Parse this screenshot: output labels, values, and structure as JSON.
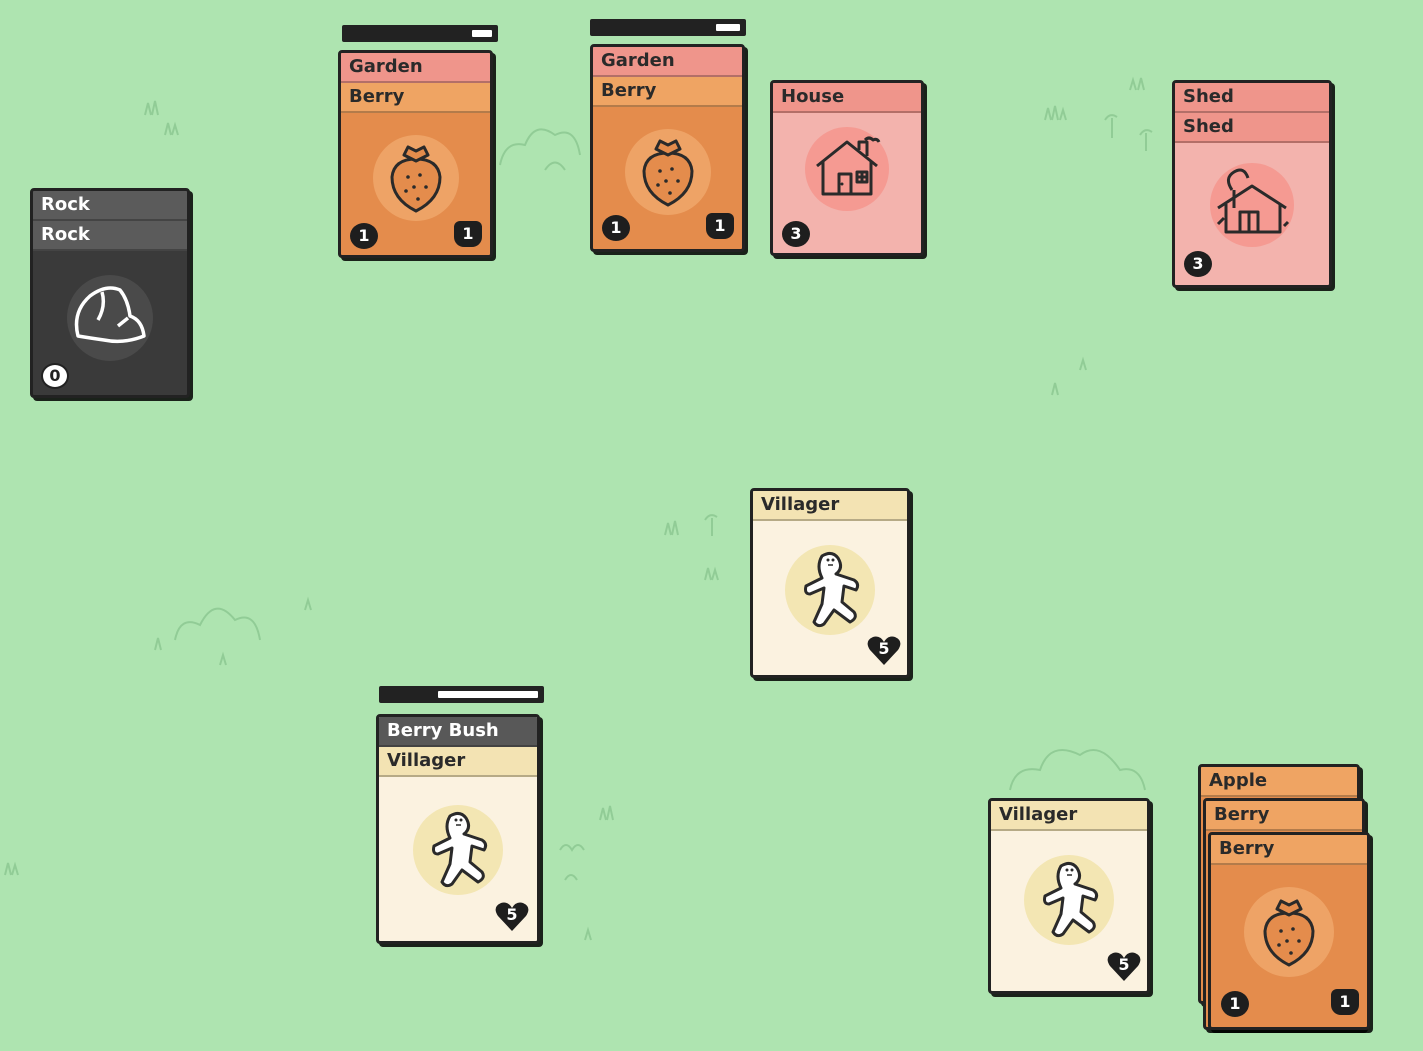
{
  "board": {
    "background": "#aee4b0",
    "colors": {
      "food": "#e48c4c",
      "structure": "#f3b3ad",
      "resource": "#3a3a3a",
      "villager": "#fbf2e0"
    }
  },
  "stacks": {
    "rock": {
      "titles": [
        "Rock",
        "Rock"
      ],
      "value": "0",
      "icon": "rock-icon"
    },
    "garden_left": {
      "titles": [
        "Garden",
        "Berry"
      ],
      "value": "1",
      "food": "1",
      "icon": "strawberry-icon",
      "progress": 0.1
    },
    "garden_right": {
      "titles": [
        "Garden",
        "Berry"
      ],
      "value": "1",
      "food": "1",
      "icon": "strawberry-icon",
      "progress": 0.15
    },
    "house": {
      "titles": [
        "House"
      ],
      "value": "3",
      "icon": "house-icon"
    },
    "shed": {
      "titles": [
        "Shed",
        "Shed"
      ],
      "value": "3",
      "icon": "shed-icon"
    },
    "villager_center": {
      "titles": [
        "Villager"
      ],
      "health": "5",
      "icon": "villager-icon"
    },
    "berry_bush": {
      "titles": [
        "Berry Bush",
        "Villager"
      ],
      "health": "5",
      "icon": "villager-icon",
      "progress": 0.62
    },
    "villager_right": {
      "titles": [
        "Villager"
      ],
      "health": "5",
      "icon": "villager-icon"
    },
    "apple": {
      "titles": [
        "Apple",
        "Berry",
        "Berry"
      ],
      "value": "1",
      "food": "1",
      "icon": "strawberry-icon"
    }
  }
}
